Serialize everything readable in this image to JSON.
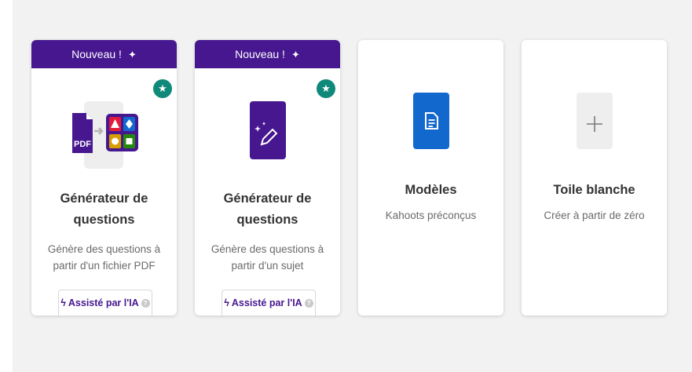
{
  "cards": [
    {
      "banner": "Nouveau !",
      "title_line1": "Générateur de",
      "title_line2": "questions",
      "desc_line1": "Génère des questions à",
      "desc_line2": "partir d'un fichier PDF",
      "chip_label": "Assisté par l'IA",
      "icon": "pdf-to-quiz-icon",
      "pdf_text": "PDF"
    },
    {
      "banner": "Nouveau !",
      "title_line1": "Générateur de",
      "title_line2": "questions",
      "desc_line1": "Génère des questions à",
      "desc_line2": "partir d'un sujet",
      "chip_label": "Assisté par l'IA",
      "icon": "magic-pen-icon"
    },
    {
      "title": "Modèles",
      "desc": "Kahoots préconçus",
      "icon": "document-icon"
    },
    {
      "title": "Toile blanche",
      "desc": "Créer à partir de zéro",
      "icon": "plus-icon"
    }
  ],
  "colors": {
    "purple": "#46178f",
    "teal": "#0f8a7a",
    "blue": "#1368ce",
    "panel": "#f2f2f2"
  }
}
